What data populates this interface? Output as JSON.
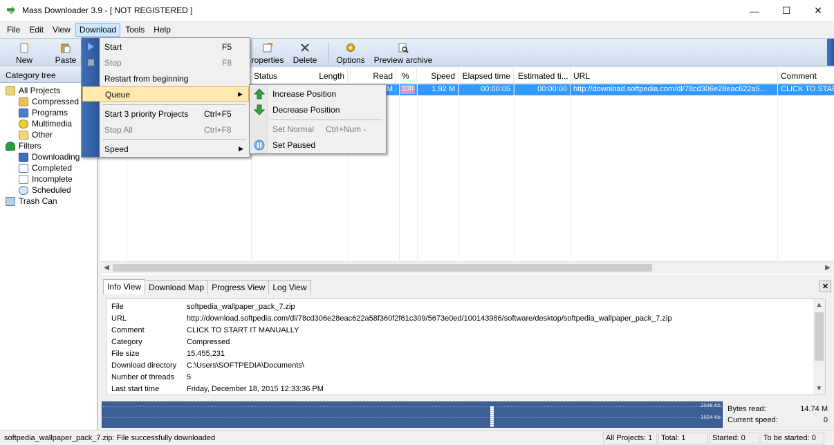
{
  "window": {
    "title": "Mass Downloader 3.9   - [ NOT REGISTERED ]",
    "minimize": "—",
    "maximize": "☐",
    "close": "✕"
  },
  "menubar": {
    "items": [
      "File",
      "Edit",
      "View",
      "Download",
      "Tools",
      "Help"
    ],
    "active": "Download"
  },
  "toolbar": {
    "new": "New",
    "paste": "Paste",
    "properties": "roperties",
    "delete": "Delete",
    "options": "Options",
    "preview": "Preview archive"
  },
  "category_tree": {
    "header": "Category tree",
    "items": [
      {
        "label": "All Projects",
        "icon": "all-projects-icon"
      },
      {
        "label": "Compressed",
        "icon": "compressed-icon"
      },
      {
        "label": "Programs",
        "icon": "programs-icon"
      },
      {
        "label": "Multimedia",
        "icon": "multimedia-icon"
      },
      {
        "label": "Other",
        "icon": "other-icon"
      },
      {
        "label": "Filters",
        "icon": "filters-icon"
      },
      {
        "label": "Downloading",
        "icon": "downloading-icon"
      },
      {
        "label": "Completed",
        "icon": "completed-icon"
      },
      {
        "label": "Incomplete",
        "icon": "incomplete-icon"
      },
      {
        "label": "Scheduled",
        "icon": "scheduled-icon"
      },
      {
        "label": "Trash Can",
        "icon": "trash-icon"
      }
    ]
  },
  "grid": {
    "columns": [
      "Status",
      "Length",
      "Read",
      "%",
      "Speed",
      "Elapsed time",
      "Estimated ti...",
      "URL",
      "Comment"
    ],
    "row": {
      "read": "M",
      "percent": "100",
      "speed": "1.92 M",
      "elapsed": "00:00:05",
      "estimated": "00:00:00",
      "url": "http://download.softpedia.com/dl/78cd306e28eac622a5...",
      "comment": "CLICK TO STAR"
    }
  },
  "download_menu": {
    "start": "Start",
    "start_sc": "F5",
    "stop": "Stop",
    "stop_sc": "F8",
    "restart": "Restart from beginning",
    "queue": "Queue",
    "start_priority": "Start 3 priority Projects",
    "start_priority_sc": "Ctrl+F5",
    "stop_all": "Stop All",
    "stop_all_sc": "Ctrl+F8",
    "speed": "Speed"
  },
  "queue_menu": {
    "increase": "Increase Position",
    "decrease": "Decrease Position",
    "set_normal": "Set Normal",
    "set_normal_sc": "Ctrl+Num -",
    "set_paused": "Set Paused"
  },
  "info": {
    "tabs": [
      "Info View",
      "Download Map",
      "Progress View",
      "Log View"
    ],
    "close": "✕",
    "rows": [
      {
        "k": "File",
        "v": "softpedia_wallpaper_pack_7.zip"
      },
      {
        "k": "URL",
        "v": "http://download.softpedia.com/dl/78cd306e28eac622a58f360f2f61c309/5673e0ed/100143986/software/desktop/softpedia_wallpaper_pack_7.zip"
      },
      {
        "k": "Comment",
        "v": "CLICK TO START IT MANUALLY"
      },
      {
        "k": "Category",
        "v": "Compressed"
      },
      {
        "k": "File size",
        "v": "15,455,231"
      },
      {
        "k": "Download directory",
        "v": "C:\\Users\\SOFTPEDIA\\Documents\\"
      },
      {
        "k": "Number of threads",
        "v": "5"
      },
      {
        "k": "Last start time",
        "v": "Friday, December 18, 2015 12:33:36 PM"
      }
    ]
  },
  "graph": {
    "label_top": "2048 Kb",
    "label_mid": "1024 Kb"
  },
  "stats": {
    "bytes_read_label": "Bytes read:",
    "bytes_read": "14.74 M",
    "current_speed_label": "Current speed:",
    "current_speed": "0"
  },
  "statusbar": {
    "message": "softpedia_wallpaper_pack_7.zip: File successfully downloaded",
    "all_projects": "All Projects: 1",
    "total": "Total: 1",
    "started": "Started: 0",
    "to_be_started": "To be started: 0"
  },
  "colors": {
    "selection": "#3399ff",
    "menu_gutter": "#2c5699",
    "highlight": "#ffe9b0"
  }
}
